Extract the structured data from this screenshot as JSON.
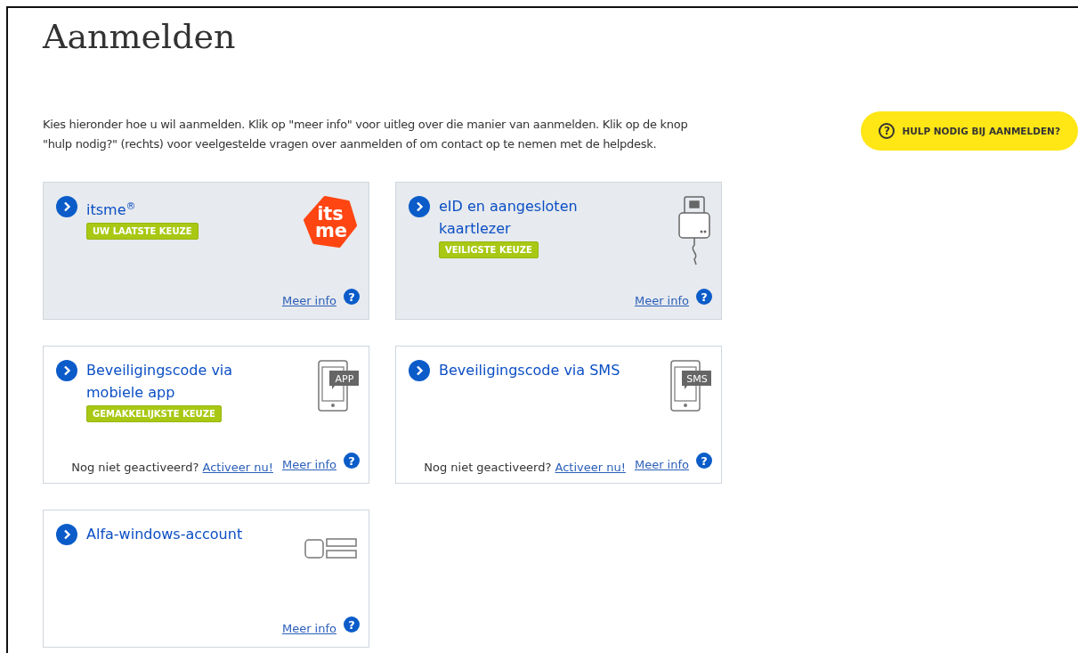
{
  "title": "Aanmelden",
  "intro": "Kies hieronder hoe u wil aanmelden. Klik op \"meer info\" voor uitleg over die manier van aanmelden. Klik op de knop \"hulp nodig?\" (rechts) voor veelgestelde vragen over aanmelden of om contact op te nemen met de helpdesk.",
  "help_button": {
    "icon": "?",
    "label": "HULP NODIG BIJ AANMELDEN?"
  },
  "options": [
    {
      "kind": "itsme",
      "title": "itsme$^{®}$",
      "badge": "UW LAATSTE KEUZE",
      "highlighted": true,
      "logo_text": [
        "its",
        "me"
      ],
      "more_info": "Meer info"
    },
    {
      "kind": "card-reader",
      "title": "eID en aangesloten kaartlezer",
      "badge": "VEILIGSTE KEUZE",
      "highlighted": true,
      "more_info": "Meer info"
    },
    {
      "kind": "phone",
      "title": "Beveiligingscode via mobiele app",
      "badge": "GEMAKKELIJKSTE KEUZE",
      "highlighted": false,
      "icon_label": "APP",
      "activation_text": "Nog niet geactiveerd?",
      "activation_link": "Activeer nu!",
      "more_info": "Meer info"
    },
    {
      "kind": "phone",
      "title": "Beveiligingscode via SMS",
      "highlighted": false,
      "icon_label": "SMS",
      "activation_text": "Nog niet geactiveerd?",
      "activation_link": "Activeer nu!",
      "more_info": "Meer info"
    },
    {
      "kind": "account",
      "title": "Alfa-windows-account",
      "highlighted": false,
      "more_info": "Meer info"
    }
  ]
}
